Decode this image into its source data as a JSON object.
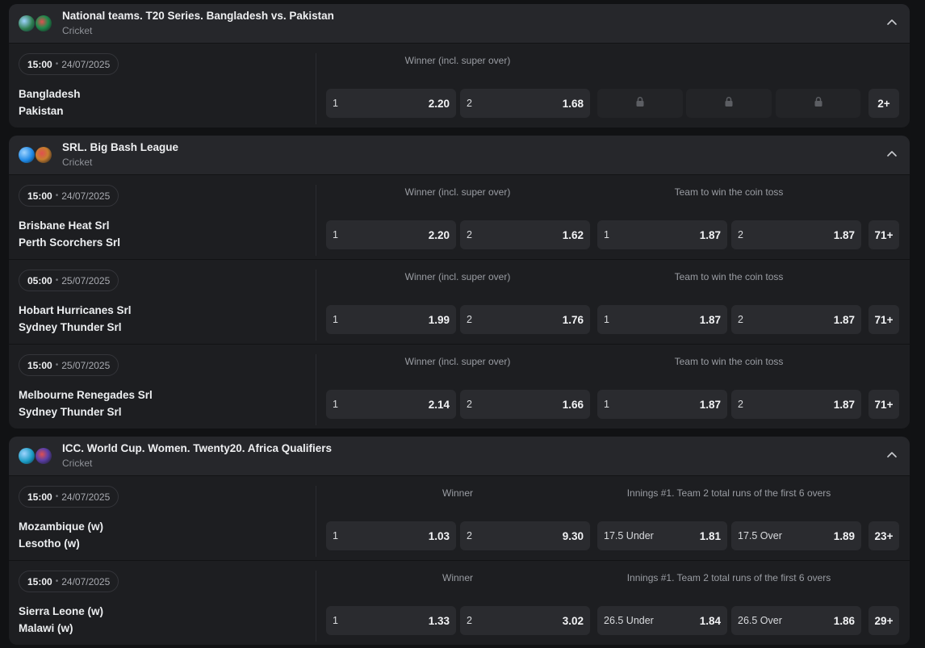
{
  "leagues": [
    {
      "name": "National teams. T20 Series. Bangladesh vs. Pakistan",
      "sport": "Cricket",
      "flag_colors": [
        "#2e7d4f",
        "#1f8a4c"
      ],
      "events": [
        {
          "time": "15:00",
          "date": "24/07/2025",
          "team1": "Bangladesh",
          "team2": "Pakistan",
          "market1": "Winner (incl. super over)",
          "market2": "",
          "odds": [
            {
              "label": "1",
              "value": "2.20"
            },
            {
              "label": "2",
              "value": "1.68"
            }
          ],
          "locked": true,
          "more": "2+"
        }
      ]
    },
    {
      "name": "SRL. Big Bash League",
      "sport": "Cricket",
      "flag_colors": [
        "#1e88e5",
        "#c77d2e"
      ],
      "events": [
        {
          "time": "15:00",
          "date": "24/07/2025",
          "team1": "Brisbane Heat Srl",
          "team2": "Perth Scorchers Srl",
          "market1": "Winner (incl. super over)",
          "market2": "Team to win the coin toss",
          "odds": [
            {
              "label": "1",
              "value": "2.20"
            },
            {
              "label": "2",
              "value": "1.62"
            },
            {
              "label": "1",
              "value": "1.87"
            },
            {
              "label": "2",
              "value": "1.87"
            }
          ],
          "more": "71+"
        },
        {
          "time": "05:00",
          "date": "25/07/2025",
          "team1": "Hobart Hurricanes Srl",
          "team2": "Sydney Thunder Srl",
          "market1": "Winner (incl. super over)",
          "market2": "Team to win the coin toss",
          "odds": [
            {
              "label": "1",
              "value": "1.99"
            },
            {
              "label": "2",
              "value": "1.76"
            },
            {
              "label": "1",
              "value": "1.87"
            },
            {
              "label": "2",
              "value": "1.87"
            }
          ],
          "more": "71+"
        },
        {
          "time": "15:00",
          "date": "25/07/2025",
          "team1": "Melbourne Renegades Srl",
          "team2": "Sydney Thunder Srl",
          "market1": "Winner (incl. super over)",
          "market2": "Team to win the coin toss",
          "odds": [
            {
              "label": "1",
              "value": "2.14"
            },
            {
              "label": "2",
              "value": "1.66"
            },
            {
              "label": "1",
              "value": "1.87"
            },
            {
              "label": "2",
              "value": "1.87"
            }
          ],
          "more": "71+"
        }
      ]
    },
    {
      "name": "ICC. World Cup. Women. Twenty20. Africa Qualifiers",
      "sport": "Cricket",
      "flag_colors": [
        "#1a9bc4",
        "#5b3fa8"
      ],
      "events": [
        {
          "time": "15:00",
          "date": "24/07/2025",
          "team1": "Mozambique (w)",
          "team2": "Lesotho (w)",
          "market1": "Winner",
          "market2": "Innings #1. Team 2 total runs of the first 6 overs",
          "odds": [
            {
              "label": "1",
              "value": "1.03"
            },
            {
              "label": "2",
              "value": "9.30"
            },
            {
              "label": "17.5 Under",
              "value": "1.81"
            },
            {
              "label": "17.5 Over",
              "value": "1.89"
            }
          ],
          "more": "23+"
        },
        {
          "time": "15:00",
          "date": "24/07/2025",
          "team1": "Sierra Leone (w)",
          "team2": "Malawi (w)",
          "market1": "Winner",
          "market2": "Innings #1. Team 2 total runs of the first 6 overs",
          "odds": [
            {
              "label": "1",
              "value": "1.33"
            },
            {
              "label": "2",
              "value": "3.02"
            },
            {
              "label": "26.5 Under",
              "value": "1.84"
            },
            {
              "label": "26.5 Over",
              "value": "1.86"
            }
          ],
          "more": "29+"
        }
      ]
    }
  ]
}
